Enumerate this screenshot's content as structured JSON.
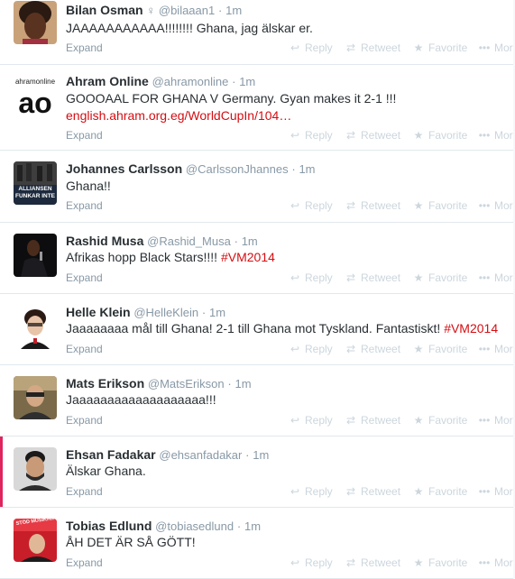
{
  "actions": {
    "reply": "Reply",
    "retweet": "Retweet",
    "favorite": "Favorite",
    "more": "More",
    "expand": "Expand"
  },
  "accent_link_color": "#d40d12",
  "tweets": [
    {
      "name": "Bilan Osman",
      "gender": "♀",
      "handle": "@bilaaan1",
      "time": "1m",
      "text": "JAAAAAAAAAAA!!!!!!!! Ghana, jag älskar er.",
      "link": "",
      "hashtag": ""
    },
    {
      "name": "Ahram Online",
      "gender": "",
      "handle": "@ahramonline",
      "time": "1m",
      "text": "GOOOAAL FOR GHANA V Germany. Gyan makes it 2-1 !!!",
      "link": "english.ahram.org.eg/WorldCupIn/104…",
      "hashtag": ""
    },
    {
      "name": "Johannes Carlsson",
      "gender": "",
      "handle": "@CarlssonJhannes",
      "time": "1m",
      "text": "Ghana!!",
      "link": "",
      "hashtag": ""
    },
    {
      "name": "Rashid Musa",
      "gender": "",
      "handle": "@Rashid_Musa",
      "time": "1m",
      "text": "Afrikas hopp Black Stars!!!! ",
      "link": "",
      "hashtag": "#VM2014"
    },
    {
      "name": "Helle Klein",
      "gender": "",
      "handle": "@HelleKlein",
      "time": "1m",
      "text": "Jaaaaaaaa mål till Ghana! 2-1 till Ghana mot Tyskland.  Fantastiskt! ",
      "link": "",
      "hashtag": "#VM2014"
    },
    {
      "name": "Mats Erikson",
      "gender": "",
      "handle": "@MatsErikson",
      "time": "1m",
      "text": "Jaaaaaaaaaaaaaaaaaaa!!!",
      "link": "",
      "hashtag": ""
    },
    {
      "name": "Ehsan Fadakar",
      "gender": "",
      "handle": "@ehsanfadakar",
      "time": "1m",
      "text": "Älskar Ghana.",
      "link": "",
      "hashtag": ""
    },
    {
      "name": "Tobias Edlund",
      "gender": "",
      "handle": "@tobiasedlund",
      "time": "1m",
      "text": "ÅH DET ÄR SÅ GÖTT!",
      "link": "",
      "hashtag": ""
    }
  ],
  "avatars": {
    "ahram_logo_top": "ahramonline",
    "ahram_logo_big": "ao",
    "johannes_sign": "ALLIANSEN FUNKAR INTE",
    "tobias_sign": "STÖD MUSIKHJÄLPEN"
  }
}
